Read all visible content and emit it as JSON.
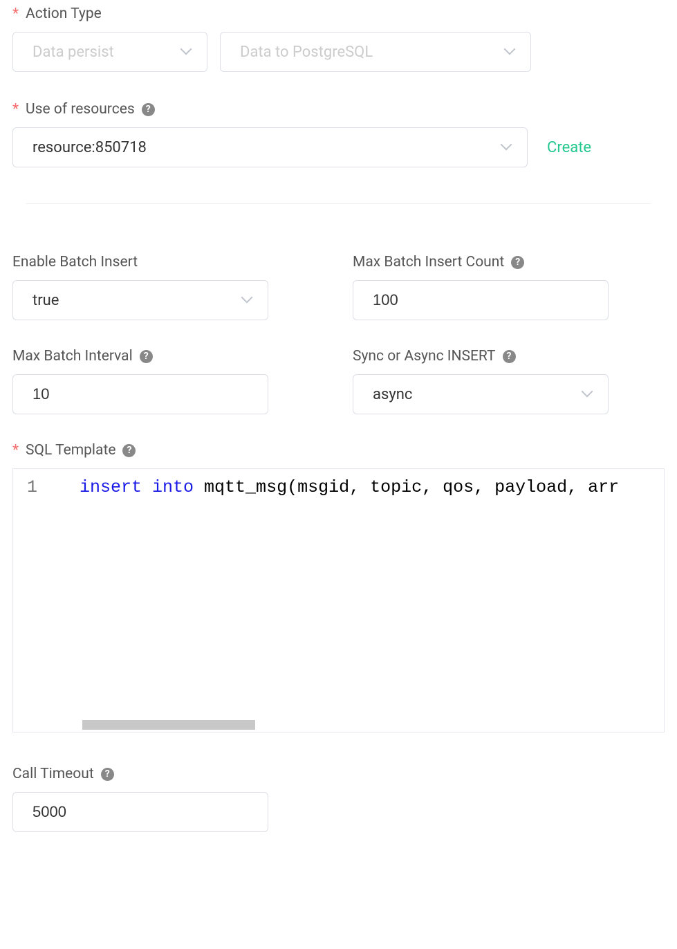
{
  "action_type": {
    "label": "Action Type",
    "select1": "Data persist",
    "select2": "Data to PostgreSQL"
  },
  "resources": {
    "label": "Use of resources",
    "value": "resource:850718",
    "create_label": "Create"
  },
  "batch": {
    "enable_label": "Enable Batch Insert",
    "enable_value": "true",
    "max_count_label": "Max Batch Insert Count",
    "max_count_value": "100",
    "interval_label": "Max Batch Interval",
    "interval_value": "10",
    "sync_label": "Sync or Async INSERT",
    "sync_value": "async"
  },
  "sql": {
    "label": "SQL Template",
    "line_number": "1",
    "kw1": "insert",
    "kw2": "into",
    "rest": " mqtt_msg(msgid, topic, qos, payload, arr"
  },
  "timeout": {
    "label": "Call Timeout",
    "value": "5000"
  }
}
